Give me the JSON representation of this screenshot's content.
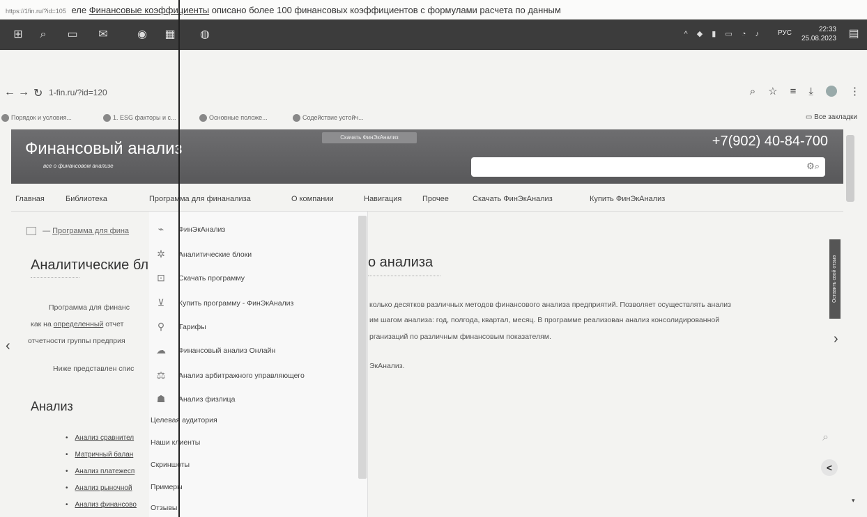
{
  "paper_line": {
    "url": "https://1fin.ru/?id=105",
    "before": "еле",
    "link": "Финансовые коэффициенты",
    "after": "описано более 100 финансовых коэффициентов с формулами расчета по данным"
  },
  "taskbar": {
    "time": "22:33",
    "date": "25.08.2023",
    "lang": "РУС"
  },
  "browser": {
    "address": "1-fin.ru/?id=120",
    "bookmarks": [
      "Порядок и условия...",
      "1. ESG факторы и с...",
      "Основные положе...",
      "Содействие устойч..."
    ],
    "all_bookmarks": "Все закладки"
  },
  "site": {
    "title": "Финансовый анализ",
    "subtitle": "все о финансовом анализе",
    "download_banner": "Скачать ФинЭкАнализ",
    "phone": "+7(902) 40-84-700"
  },
  "menu": [
    "Главная",
    "Библиотека",
    "Программа для финанализа",
    "О компании",
    "Навигация",
    "Прочее",
    "Скачать ФинЭкАнализ",
    "Купить ФинЭкАнализ"
  ],
  "breadcrumb": {
    "separator": "—",
    "current": "Программа для фина"
  },
  "page": {
    "title_left": "Аналитические бл",
    "title_right": "о анализа",
    "para1_left": "Программа для финанс",
    "para1_right": "колько десятков различных методов финансового анализа предприятий. Позволяет осуществлять анализ",
    "para2_left_a": "как на",
    "para2_left_link": "определенный",
    "para2_left_b": "отчет",
    "para2_right": "им шагом анализа: год, полгода, квартал, месяц. В программе реализован анализ консолидированной",
    "para3_left": "отчетности группы предприя",
    "para3_right": "рганизаций по различным финансовым показателям.",
    "para4_left": "Ниже представлен спис",
    "para4_right": "ЭкАнализ.",
    "analysis_heading": "Анализ",
    "analysis_items": [
      "Анализ сравнител",
      "Матричный балан",
      "Анализ платежесп",
      "Анализ рыночной",
      "Анализ финансово"
    ]
  },
  "dropdown": {
    "icon_items": [
      {
        "label": "ФинЭкАнализ",
        "icon": "chart-icon"
      },
      {
        "label": "Аналитические блоки",
        "icon": "gear-icon"
      },
      {
        "label": "Скачать программу",
        "icon": "download-icon"
      },
      {
        "label": "Купить программу - ФинЭкАнализ",
        "icon": "cart-icon"
      },
      {
        "label": "Тарифы",
        "icon": "tag-icon"
      },
      {
        "label": "Финансовый анализ Онлайн",
        "icon": "cloud-icon"
      },
      {
        "label": "Анализ арбитражного управляющего",
        "icon": "scales-icon"
      },
      {
        "label": "Анализ физлица",
        "icon": "person-icon"
      }
    ],
    "plain_items": [
      "Целевая аудитория",
      "Наши клиенты",
      "Скриншоты",
      "Примеры",
      "Отзывы"
    ]
  },
  "side": {
    "feedback": "Оставить свой отзыв"
  }
}
